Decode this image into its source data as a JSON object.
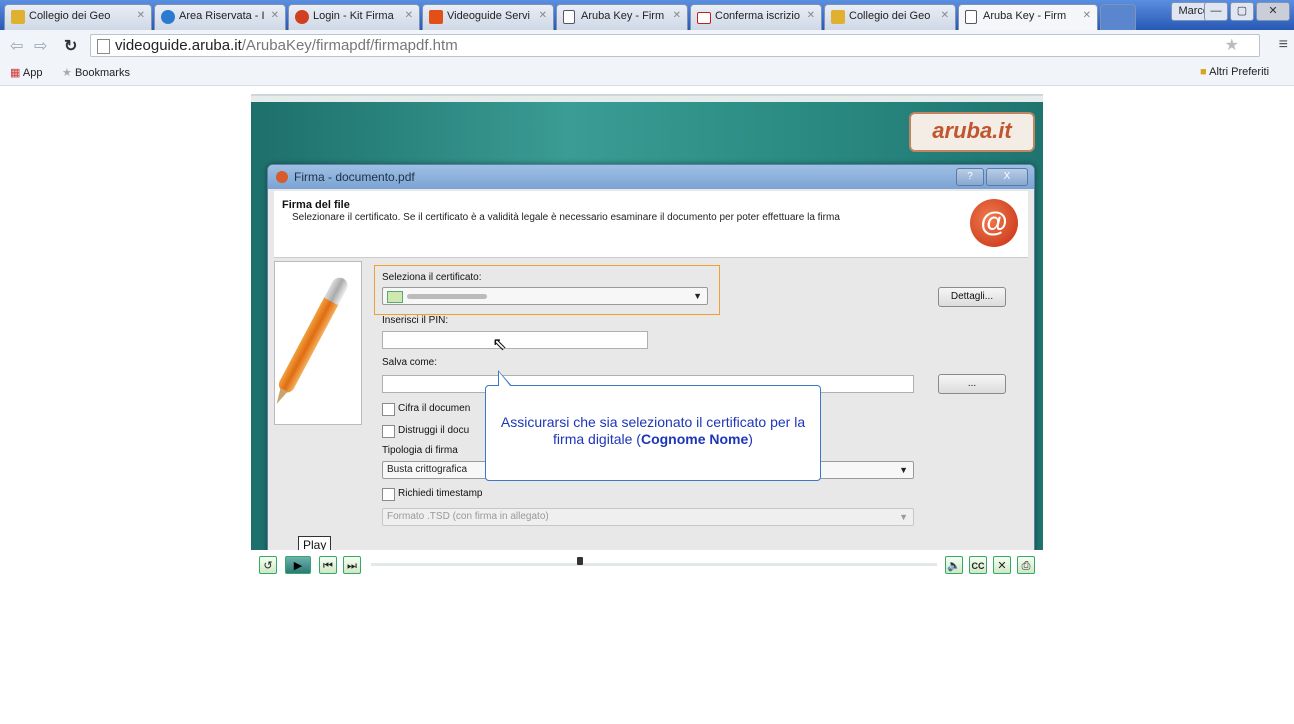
{
  "browser": {
    "tabs": [
      {
        "label": "Collegio dei Geo",
        "favicon_color": "#e0b030"
      },
      {
        "label": "Area Riservata - I",
        "favicon_color": "#2a7ad0"
      },
      {
        "label": "Login - Kit Firma",
        "favicon_color": "#d04020"
      },
      {
        "label": "Videoguide Servi",
        "favicon_color": "#e05018"
      },
      {
        "label": "Aruba Key - Firm",
        "favicon_color": "#556"
      },
      {
        "label": "Conferma iscrizio",
        "favicon_color": "#c02020"
      },
      {
        "label": "Collegio dei Geo",
        "favicon_color": "#e0b030"
      },
      {
        "label": "Aruba Key - Firm",
        "favicon_color": "#556"
      }
    ],
    "user": "Marco",
    "url_host": "videoguide.aruba.it",
    "url_path": "/ArubaKey/firmapdf/firmapdf.htm",
    "bookmarks": {
      "apps": "App",
      "bookmarks": "Bookmarks",
      "other": "Altri Preferiti"
    }
  },
  "video": {
    "logo": "aruba.it",
    "dialog": {
      "title": "Firma - documento.pdf",
      "help_btn": "?",
      "close_btn": "X",
      "header_title": "Firma del file",
      "header_desc": "Selezionare il certificato. Se il certificato è a validità legale è necessario esaminare il documento per poter effettuare la firma",
      "select_cert_label": "Seleziona il certificato:",
      "details_btn": "Dettagli...",
      "pin_label": "Inserisci il PIN:",
      "save_as_label": "Salva come:",
      "browse_btn": "...",
      "encrypt_label": "Cifra il documen",
      "destroy_label": "Distruggi il docu",
      "signature_type_label": "Tipologia di firma",
      "signature_type_value": "Busta crittografica",
      "timestamp_label": "Richiedi timestamp",
      "format_value": "Formato .TSD (con firma in allegato)"
    },
    "callout": {
      "text": "Assicurarsi che sia selezionato il certificato per la firma digitale (",
      "bold": "Cognome Nome",
      "end": ")"
    },
    "tooltip": "Play",
    "controls": {
      "cc_label": "CC"
    },
    "progress": 0.37
  }
}
